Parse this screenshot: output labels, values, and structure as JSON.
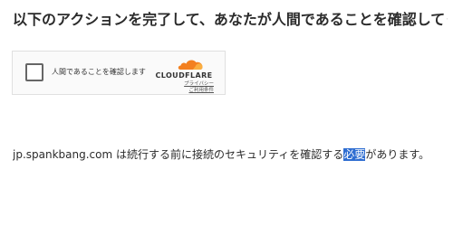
{
  "heading": "以下のアクションを完了して、あなたが人間であることを確認してください。",
  "widget": {
    "checkbox_label": "人間であることを確認します",
    "brand_name": "CLOUDFLARE",
    "privacy_link": "プライバシー",
    "terms_link": "ご利用条件",
    "colors": {
      "cloud_orange": "#f38020",
      "cloud_light": "#faae40"
    }
  },
  "message": {
    "domain": "jp.spankbang.com",
    "text_before": " は続行する前に接続のセキュリティを確認する",
    "highlighted": "必要",
    "text_after": "があります。",
    "highlight_color": "#2e6dd1"
  }
}
